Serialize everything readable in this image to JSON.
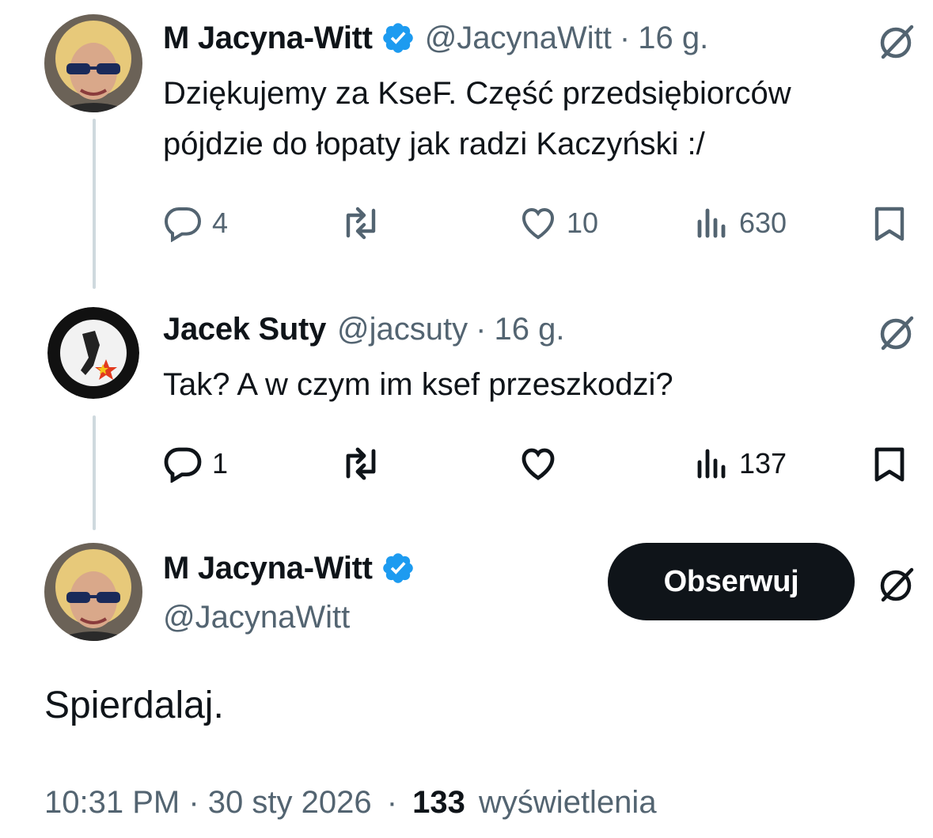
{
  "tweet1": {
    "author_name": "M Jacyna-Witt",
    "handle": "@JacynaWitt",
    "separator": "·",
    "time": "16 g.",
    "text_line1": "Dziękujemy za KseF. Część przedsiębiorców",
    "text_line2": "pójdzie do łopaty jak radzi Kaczyński :/",
    "replies": "4",
    "likes": "10",
    "views": "630"
  },
  "tweet2": {
    "author_name": "Jacek Suty",
    "handle": "@jacsuty",
    "separator": "·",
    "time": "16 g.",
    "text": "Tak? A w czym im ksef przeszkodzi?",
    "replies": "1",
    "views": "137"
  },
  "tweet3": {
    "author_name": "M Jacyna-Witt",
    "handle": "@JacynaWitt",
    "follow_label": "Obserwuj",
    "text": "Spierdalaj.",
    "timestamp": "10:31 PM · 30 sty 2026",
    "separator": "·",
    "views_count": "133",
    "views_label": "wyświetlenia"
  },
  "colors": {
    "text": "#0f1419",
    "secondary": "#536471",
    "verified": "#1d9bf0",
    "thread_line": "#cfd9de",
    "follow_button_bg": "#0f1419"
  },
  "icons": {
    "reply": "reply-icon",
    "repost": "repost-icon",
    "like": "heart-icon",
    "views": "views-chart-icon",
    "bookmark": "bookmark-icon",
    "grok": "grok-icon",
    "verified": "verified-badge-icon"
  }
}
